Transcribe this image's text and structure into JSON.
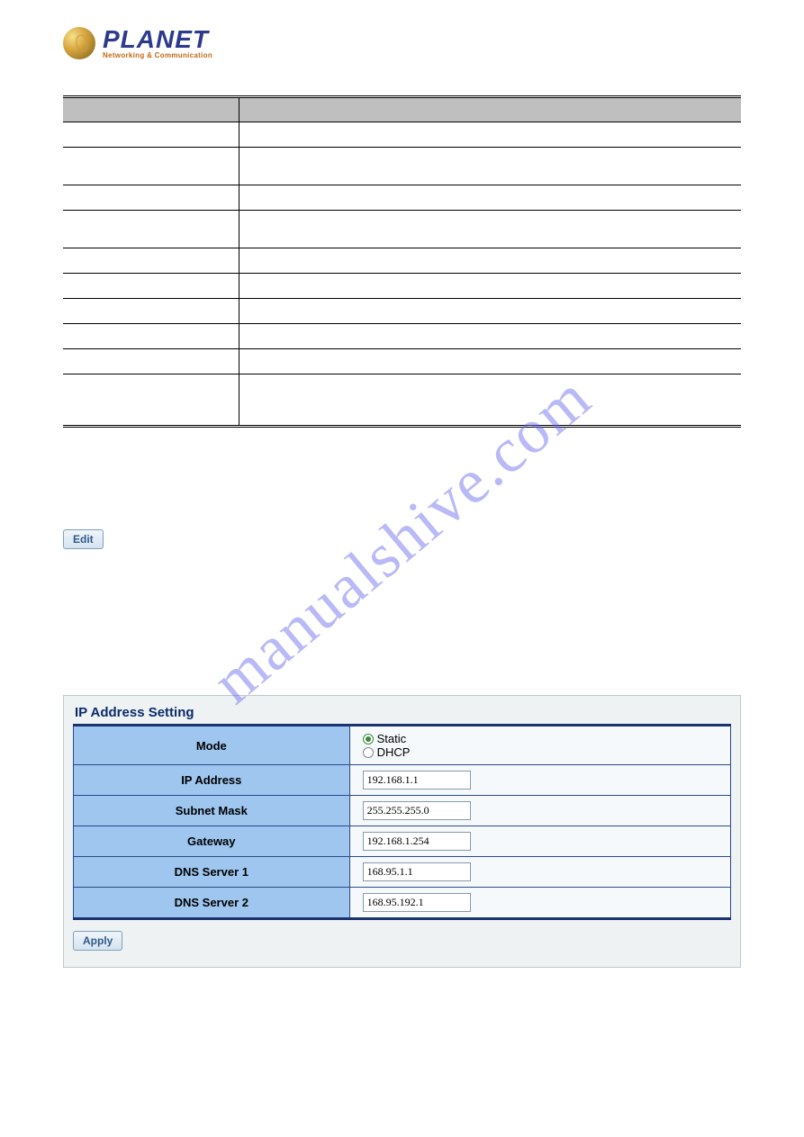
{
  "logo": {
    "word": "PLANET",
    "tagline": "Networking & Communication"
  },
  "watermark": "manualshive.com",
  "edit_button": "Edit",
  "ip_panel": {
    "title": "IP Address Setting",
    "rows": {
      "mode_label": "Mode",
      "mode_static": "Static",
      "mode_dhcp": "DHCP",
      "ip_label": "IP Address",
      "ip_value": "192.168.1.1",
      "mask_label": "Subnet Mask",
      "mask_value": "255.255.255.0",
      "gw_label": "Gateway",
      "gw_value": "192.168.1.254",
      "dns1_label": "DNS Server 1",
      "dns1_value": "168.95.1.1",
      "dns2_label": "DNS Server 2",
      "dns2_value": "168.95.192.1"
    },
    "apply_button": "Apply"
  }
}
